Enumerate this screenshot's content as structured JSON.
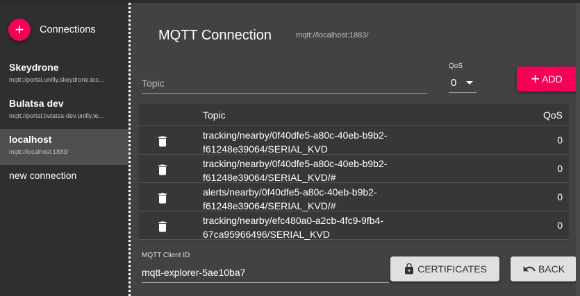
{
  "sidebar": {
    "add_icon": "plus-icon",
    "header_label": "Connections",
    "connections": [
      {
        "name": "Skeydrone",
        "url": "mqtt://portal.unifly.skeydrone.tec..."
      },
      {
        "name": "Bulatsa dev",
        "url": "mqtt://portal.bulatsa-dev.unifly.te..."
      },
      {
        "name": "localhost",
        "url": "mqtt://localhost:1883/",
        "selected": true
      },
      {
        "name": "new connection",
        "url": ""
      }
    ]
  },
  "main": {
    "title": "MQTT Connection",
    "subtitle": "mqtt://localhost:1883/",
    "topic_placeholder": "Topic",
    "qos_label": "QoS",
    "qos_value": "0",
    "add_label": "ADD",
    "table": {
      "headers": {
        "topic": "Topic",
        "qos": "QoS"
      },
      "rows": [
        {
          "topic_line1": "tracking/nearby/0f40dfe5-a80c-40eb-b9b2-",
          "topic_line2": "f61248e39064/SERIAL_KVD",
          "qos": "0"
        },
        {
          "topic_line1": "tracking/nearby/0f40dfe5-a80c-40eb-b9b2-",
          "topic_line2": "f61248e39064/SERIAL_KVD/#",
          "qos": "0"
        },
        {
          "topic_line1": "alerts/nearby/0f40dfe5-a80c-40eb-b9b2-",
          "topic_line2": "f61248e39064/SERIAL_KVD/#",
          "qos": "0"
        },
        {
          "topic_line1": "tracking/nearby/efc480a0-a2cb-4fc9-9fb4-",
          "topic_line2": "67ca95966496/SERIAL_KVD",
          "qos": "0"
        }
      ]
    },
    "client_id_label": "MQTT Client ID",
    "client_id_value": "mqtt-explorer-5ae10ba7",
    "certificates_label": "CERTIFICATES",
    "back_label": "BACK"
  },
  "colors": {
    "accent": "#f50057",
    "background": "#424242",
    "sidebar": "#2f2f2f"
  }
}
